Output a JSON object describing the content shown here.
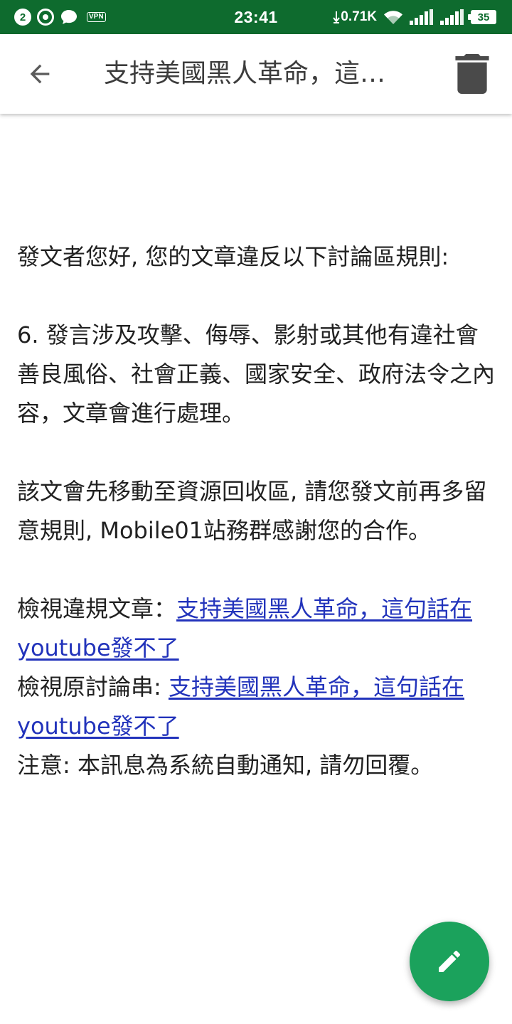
{
  "status_bar": {
    "notification_count": "2",
    "vpn_label": "VPN",
    "time": "23:41",
    "net_speed": "0.71K",
    "battery": "35"
  },
  "app_bar": {
    "title": "支持美國黑人革命，這句話在youtube發不了",
    "back_icon": "arrow-back-icon",
    "delete_icon": "trash-icon"
  },
  "message": {
    "greeting": "發文者您好, 您的文章違反以下討論區規則:",
    "rule": "6. 發言涉及攻擊、侮辱、影射或其他有違社會善良風俗、社會正義、國家安全、政府法令之內容，文章會進行處理。",
    "notice": "該文會先移動至資源回收區, 請您發文前再多留意規則, Mobile01站務群感謝您的合作。",
    "view_article_label": "檢視違規文章：",
    "view_article_link": "支持美國黑人革命，這句話在youtube發不了",
    "view_thread_label": "檢視原討論串: ",
    "view_thread_link": "支持美國黑人革命，這句話在youtube發不了",
    "footer_note": "注意: 本訊息為系統自動通知, 請勿回覆。"
  },
  "fab": {
    "icon": "pencil-icon"
  },
  "colors": {
    "status_bar": "#0e6b2e",
    "link": "#2233bb",
    "fab": "#1ba25c"
  }
}
